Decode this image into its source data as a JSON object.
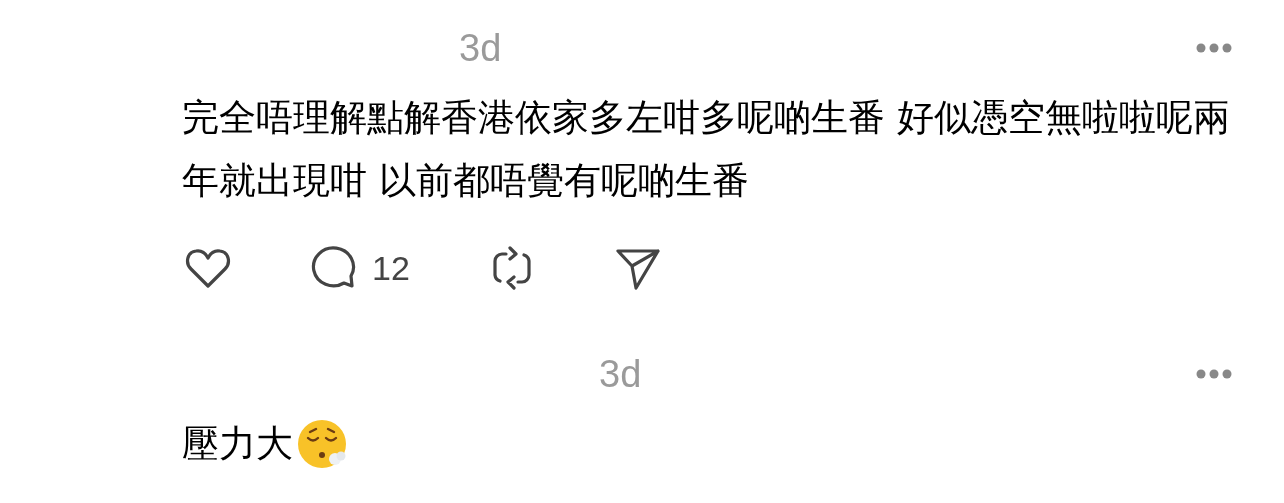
{
  "posts": [
    {
      "time": "3d",
      "text": "完全唔理解點解香港依家多左咁多呢啲生番 好似憑空無啦啦呢兩年就出現咁 以前都唔覺有呢啲生番",
      "actions": {
        "reply_count": "12"
      }
    },
    {
      "time": "3d",
      "text": "壓力大",
      "emoji": true
    }
  ]
}
